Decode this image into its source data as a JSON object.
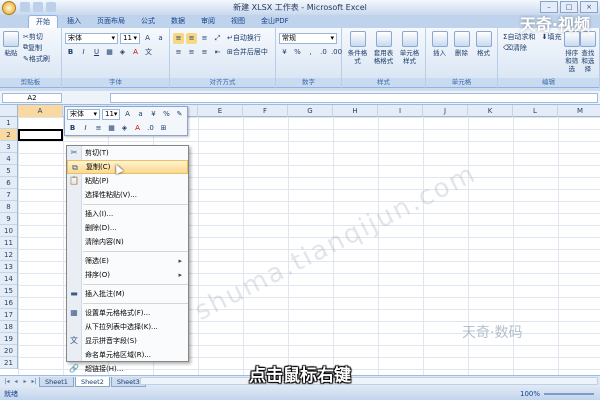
{
  "window": {
    "title": "新建 XLSX 工作表 - Microsoft Excel"
  },
  "ribbon": {
    "tabs": [
      "开始",
      "插入",
      "页面布局",
      "公式",
      "数据",
      "审阅",
      "视图",
      "金山PDF"
    ],
    "active_tab": 0,
    "clipboard": {
      "paste": "粘贴",
      "cut": "剪切",
      "copy": "复制",
      "format_painter": "格式刷",
      "label": "剪贴板"
    },
    "font": {
      "name": "宋体",
      "size": "11",
      "label": "字体"
    },
    "alignment": {
      "wrap": "自动换行",
      "merge": "合并后居中",
      "label": "对齐方式"
    },
    "number": {
      "format": "常规",
      "label": "数字"
    },
    "styles": {
      "conditional": "条件格式",
      "table": "套用表格格式",
      "cell_styles": "单元格样式",
      "label": "样式"
    },
    "cells": {
      "insert": "插入",
      "delete": "删除",
      "format": "格式",
      "label": "单元格"
    },
    "editing": {
      "autosum": "自动求和",
      "fill": "填充",
      "clear": "清除",
      "sort": "排序和筛选",
      "find": "查找和选择",
      "label": "编辑"
    }
  },
  "formula_bar": {
    "name_box": "A2"
  },
  "mini_toolbar": {
    "font": "宋体",
    "size": "11"
  },
  "grid": {
    "columns": [
      "A",
      "B",
      "C",
      "D",
      "E",
      "F",
      "G",
      "H",
      "I",
      "J",
      "K",
      "L",
      "M"
    ],
    "rows": [
      "1",
      "2",
      "3",
      "4",
      "5",
      "6",
      "7",
      "8",
      "9",
      "10",
      "11",
      "12",
      "13",
      "14",
      "15",
      "16",
      "17",
      "18",
      "19",
      "20",
      "21"
    ]
  },
  "context_menu": {
    "cut": "剪切(T)",
    "copy": "复制(C)",
    "paste": "粘贴(P)",
    "paste_special": "选择性粘贴(V)...",
    "insert": "插入(I)...",
    "delete": "删除(D)...",
    "clear": "清除内容(N)",
    "filter": "筛选(E)",
    "sort": "排序(O)",
    "insert_comment": "插入批注(M)",
    "format_cells": "设置单元格格式(F)...",
    "pick_list": "从下拉列表中选择(K)...",
    "phonetic": "显示拼音字段(S)",
    "define_name": "命名单元格区域(R)...",
    "hyperlink": "超链接(H)..."
  },
  "sheets": [
    "Sheet1",
    "Sheet2",
    "Sheet3"
  ],
  "active_sheet": 1,
  "status": {
    "ready": "就绪",
    "zoom": "100%"
  },
  "overlay": {
    "watermark": "shuma.tianqijun.com",
    "logo_top": "天奇·视频",
    "logo_bottom": "天奇·数码",
    "caption": "点击鼠标右键"
  }
}
